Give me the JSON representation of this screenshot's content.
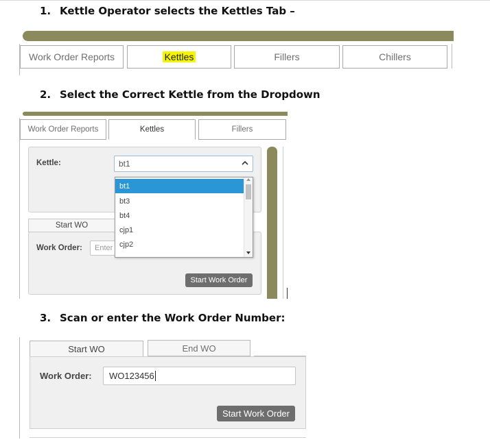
{
  "steps": [
    {
      "num": "1.",
      "text": "Kettle Operator selects the Kettles Tab –"
    },
    {
      "num": "2.",
      "text": "Select the Correct Kettle from the Dropdown"
    },
    {
      "num": "3.",
      "text": "Scan or enter the Work Order Number:"
    }
  ],
  "shot1": {
    "tabs": [
      "Work Order Reports",
      "Kettles",
      "Fillers",
      "Chillers"
    ]
  },
  "shot2": {
    "tabs": [
      "Work Order Reports",
      "Kettles",
      "Fillers"
    ],
    "kettle_label": "Kettle:",
    "kettle_value": "bt1",
    "dropdown_options": [
      "bt1",
      "bt3",
      "bt4",
      "cjp1",
      "cjp2"
    ],
    "selected_option": "bt1",
    "subtab": "Start WO",
    "work_order_label": "Work Order:",
    "work_order_placeholder": "Enter",
    "start_button": "Start Work Order"
  },
  "shot3": {
    "tabs": [
      "Start WO",
      "End WO"
    ],
    "work_order_label": "Work Order:",
    "work_order_value": "WO123456",
    "start_button": "Start Work Order"
  },
  "colors": {
    "olive_bar": "#8a8a5c",
    "highlight": "#f5f500",
    "selected_option": "#2a96d6",
    "button": "#6e6e6e"
  }
}
